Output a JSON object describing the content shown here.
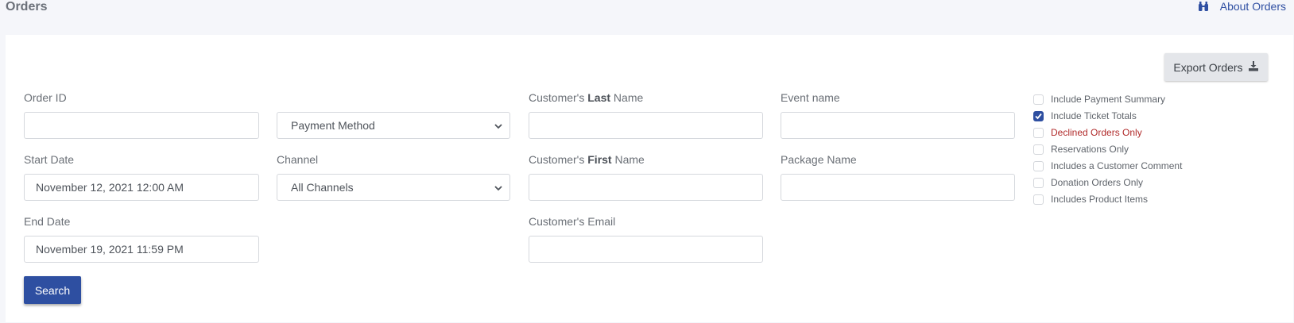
{
  "header": {
    "title": "Orders",
    "about_link": "About Orders",
    "about_icon": "binoculars-icon"
  },
  "toolbar": {
    "export_label": "Export Orders",
    "export_icon": "download-icon"
  },
  "form": {
    "order_id": {
      "label": "Order ID",
      "value": ""
    },
    "payment_method": {
      "value": "Payment Method"
    },
    "start_date": {
      "label": "Start Date",
      "value": "November 12, 2021 12:00 AM"
    },
    "channel": {
      "label": "Channel",
      "value": "All Channels"
    },
    "end_date": {
      "label": "End Date",
      "value": "November 19, 2021 11:59 PM"
    },
    "last_name": {
      "label_pre": "Customer's ",
      "label_bold": "Last",
      "label_post": " Name",
      "value": ""
    },
    "first_name": {
      "label_pre": "Customer's ",
      "label_bold": "First",
      "label_post": " Name",
      "value": ""
    },
    "email": {
      "label": "Customer's Email",
      "value": ""
    },
    "event_name": {
      "label": "Event name",
      "value": ""
    },
    "package_name": {
      "label": "Package Name",
      "value": ""
    },
    "search_label": "Search"
  },
  "options": [
    {
      "label": "Include Payment Summary",
      "checked": false
    },
    {
      "label": "Include Ticket Totals",
      "checked": true
    },
    {
      "label": "Declined Orders Only",
      "checked": false,
      "color": "#b02a2a"
    },
    {
      "label": "Reservations Only",
      "checked": false
    },
    {
      "label": "Includes a Customer Comment",
      "checked": false
    },
    {
      "label": "Donation Orders Only",
      "checked": false
    },
    {
      "label": "Includes Product Items",
      "checked": false
    }
  ],
  "colors": {
    "primary": "#2e4fa1",
    "danger": "#b02a2a"
  }
}
